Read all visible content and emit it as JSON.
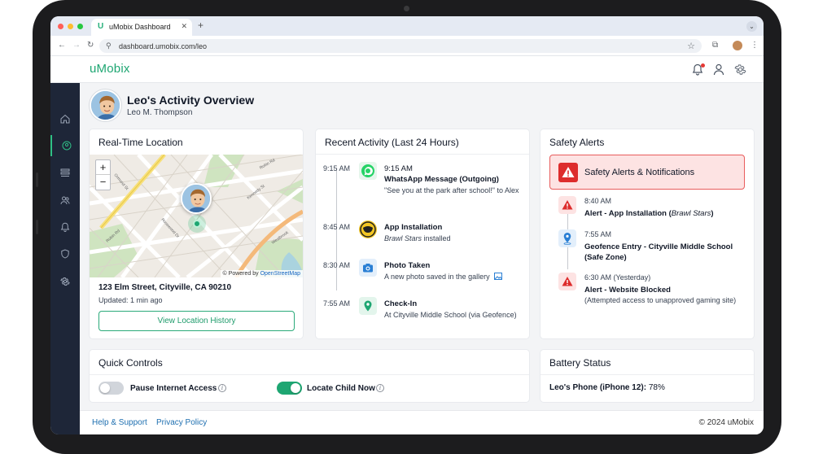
{
  "browser": {
    "tab_title": "uMobix Dashboard",
    "tab_logo": "U",
    "url": "dashboard.umobix.com/leo"
  },
  "app": {
    "brand": "uMobix",
    "header_icons": [
      "bell-icon",
      "user-icon",
      "gear-icon"
    ],
    "accent_color": "#1ea672",
    "sidebar_color": "#1e2638",
    "sidebar_items": [
      "home-icon",
      "location-icon",
      "messages-icon",
      "contacts-icon",
      "notifications-icon",
      "shield-icon",
      "settings-icon"
    ]
  },
  "profile": {
    "name": "Leo's Activity Overview",
    "full_name": "Leo M. Thompson"
  },
  "location": {
    "title": "Real-Time Location",
    "zoom_in": "+",
    "zoom_out": "−",
    "attribution_prefix": "© Powered by",
    "attribution_link": "OpenStreetMap",
    "address": "123 Elm Street, Cityville, CA 90210",
    "updated": "Updated: 1 min ago",
    "button": "View Location History",
    "street_labels": [
      "Ormond St",
      "Rosewood Dr",
      "Kennedy St",
      "Robin Rd",
      "Robin Rd",
      "Westbrook"
    ]
  },
  "activity": {
    "title": "Recent Activity (Last 24 Hours)",
    "items": [
      {
        "time": "9:15 AM",
        "icon": "whatsapp-icon",
        "title": "9:15 AM",
        "subtitle": "WhatsApp Message (Outgoing)",
        "desc": "\"See you at the park after school!\" to Alex"
      },
      {
        "time": "8:45 AM",
        "icon": "game-app-icon",
        "title": "App Installation",
        "desc_italic": "Brawl Stars",
        "desc": " installed"
      },
      {
        "time": "8:30 AM",
        "icon": "camera-icon",
        "title": "Photo Taken",
        "desc": "A new photo saved in the gallery"
      },
      {
        "time": "7:55 AM",
        "icon": "map-pin-icon",
        "title": "Check-In",
        "desc": "At Cityville Middle School (via Geofence)"
      }
    ]
  },
  "alerts": {
    "title": "Safety Alerts",
    "banner": "Safety Alerts & Notifications",
    "items": [
      {
        "time": "8:40 AM",
        "title": "Alert - App Installation (",
        "title_italic": "Brawl Stars",
        "title_end": ")",
        "icon": "warning-icon"
      },
      {
        "time": "7:55 AM",
        "title": "Geofence Entry - Cityville Middle School (Safe Zone)",
        "icon": "location-pin-icon"
      },
      {
        "time": "6:30 AM (Yesterday)",
        "title": "Alert - Website Blocked",
        "desc": "(Attempted access to unapproved gaming site)",
        "icon": "warning-icon"
      }
    ]
  },
  "controls": {
    "title": "Quick Controls",
    "pause_label": "Pause Internet Access",
    "pause_on": false,
    "locate_label": "Locate Child Now",
    "locate_on": true,
    "info": "i"
  },
  "battery": {
    "title": "Battery Status",
    "device": "Leo's Phone (iPhone 12):",
    "level": "78%"
  },
  "footer": {
    "help": "Help & Support",
    "privacy": "Privacy Policy",
    "copyright": "© 2024 uMobix"
  }
}
